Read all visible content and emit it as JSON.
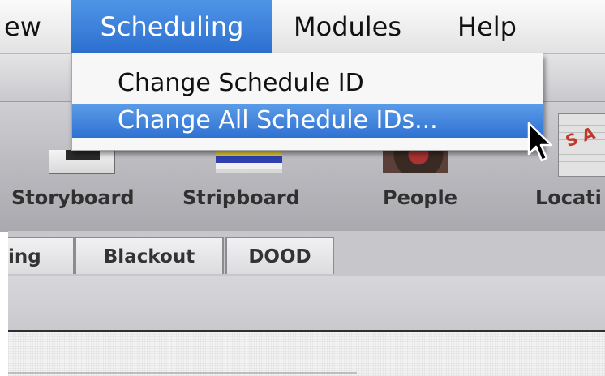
{
  "menubar": {
    "items": [
      {
        "label": "ew"
      },
      {
        "label": "Scheduling"
      },
      {
        "label": "Modules"
      },
      {
        "label": "Help"
      }
    ]
  },
  "dropdown": {
    "items": [
      {
        "label": "Change Schedule ID"
      },
      {
        "label": "Change All Schedule IDs..."
      }
    ]
  },
  "toolbar": {
    "buttons": [
      {
        "label": "Storyboard"
      },
      {
        "label": "Stripboard"
      },
      {
        "label": "People"
      },
      {
        "label": "Locati"
      }
    ]
  },
  "tabs": [
    {
      "label": "ing"
    },
    {
      "label": "Blackout"
    },
    {
      "label": "DOOD"
    }
  ],
  "colors": {
    "menu_highlight": "#3a80dc",
    "menubar_bg": "#efefef",
    "toolbar_bg": "#bdbdc2"
  }
}
